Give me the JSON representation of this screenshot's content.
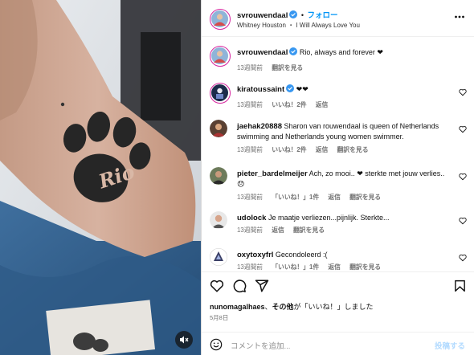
{
  "post": {
    "author": "svrouwendaal",
    "follow_label": "フォロー",
    "music": "Whitney Houston ・ I Will Always Love You",
    "caption": "Rio, always and forever ❤",
    "caption_time": "13週間前",
    "see_translation": "翻訳を見る"
  },
  "tattoo_text": "Rio",
  "comments": [
    {
      "user": "kiratoussaint",
      "text": "❤❤",
      "time": "13週間前",
      "likes": "いいね！2件",
      "reply": "返信",
      "translate": ""
    },
    {
      "user": "jaehak20888",
      "text": "Sharon van rouwendaal is queen of Netherlands swimming and Netherlands young women swimmer.",
      "time": "13週間前",
      "likes": "いいね！2件",
      "reply": "返信",
      "translate": "翻訳を見る"
    },
    {
      "user": "pieter_bardelmeijer",
      "text": "Ach, zo mooi.. ❤ sterkte met jouw verlies.. 😞",
      "time": "13週間前",
      "likes": "「いいね！」1件",
      "reply": "返信",
      "translate": "翻訳を見る"
    },
    {
      "user": "udolock",
      "text": "Je maatje verliezen...pijnlijk. Sterkte...",
      "time": "13週間前",
      "likes": "",
      "reply": "返信",
      "translate": "翻訳を見る"
    },
    {
      "user": "oxytoxyfrl",
      "text": "Gecondoleerd :(",
      "time": "13週間前",
      "likes": "「いいね！」1件",
      "reply": "返信",
      "translate": "翻訳を見る"
    }
  ],
  "likes_summary": {
    "user": "nunomagalhaes",
    "sep": "、",
    "others": "その他",
    "suffix": "が「いいね！」しました"
  },
  "post_date": "5月8日",
  "composer": {
    "placeholder": "コメントを追加...",
    "post_label": "投稿する"
  },
  "colors": {
    "accent": "#0095f6",
    "muted": "#737373",
    "verified": "#3897f0"
  }
}
